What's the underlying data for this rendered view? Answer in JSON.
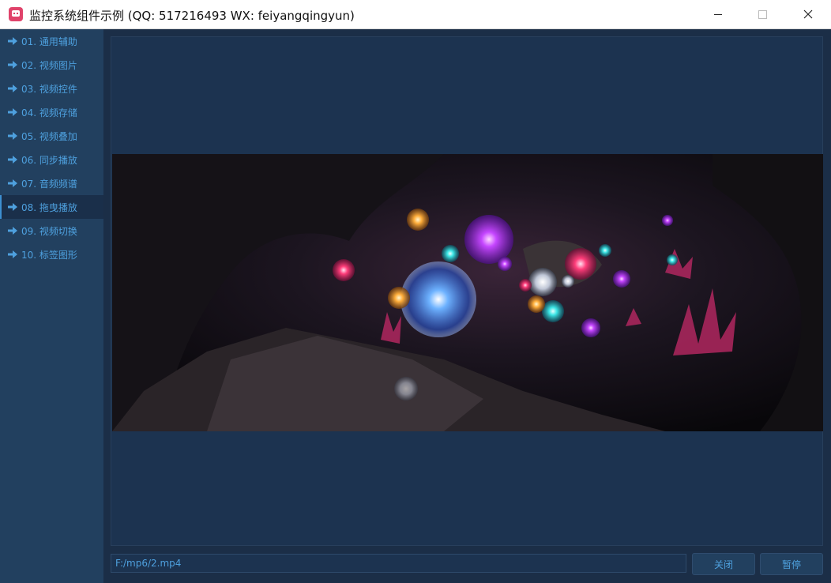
{
  "window": {
    "title": "监控系统组件示例 (QQ: 517216493  WX: feiyangqingyun)"
  },
  "colors": {
    "sidebar_bg": "#22405f",
    "content_bg": "#1b2e47",
    "accent_text": "#4ea0de",
    "active_item_bg": "#1a2f4a"
  },
  "sidebar": {
    "active_index": 7,
    "items": [
      {
        "label": "01. 通用辅助",
        "icon": "arrow-right-icon"
      },
      {
        "label": "02. 视频图片",
        "icon": "arrow-right-icon"
      },
      {
        "label": "03. 视频控件",
        "icon": "arrow-right-icon"
      },
      {
        "label": "04. 视频存储",
        "icon": "arrow-right-icon"
      },
      {
        "label": "05. 视频叠加",
        "icon": "arrow-right-icon"
      },
      {
        "label": "06. 同步播放",
        "icon": "arrow-right-icon"
      },
      {
        "label": "07. 音频频谱",
        "icon": "arrow-right-icon"
      },
      {
        "label": "08. 拖曳播放",
        "icon": "arrow-right-icon"
      },
      {
        "label": "09. 视频切换",
        "icon": "arrow-right-icon"
      },
      {
        "label": "10. 标签图形",
        "icon": "arrow-right-icon"
      }
    ]
  },
  "player": {
    "file_path": "F:/mp6/2.mp4",
    "close_label": "关闭",
    "pause_label": "暂停"
  }
}
